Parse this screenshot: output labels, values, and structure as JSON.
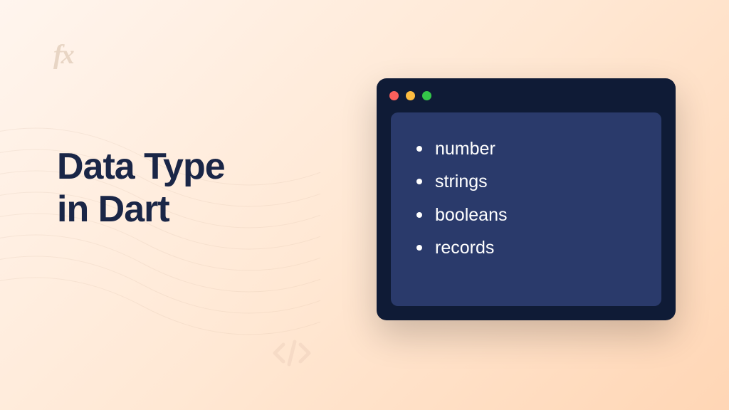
{
  "logo": "fx",
  "title_line1": "Data Type",
  "title_line2": "in Dart",
  "types": {
    "item0": "number",
    "item1": "strings",
    "item2": "booleans",
    "item3": "records"
  }
}
